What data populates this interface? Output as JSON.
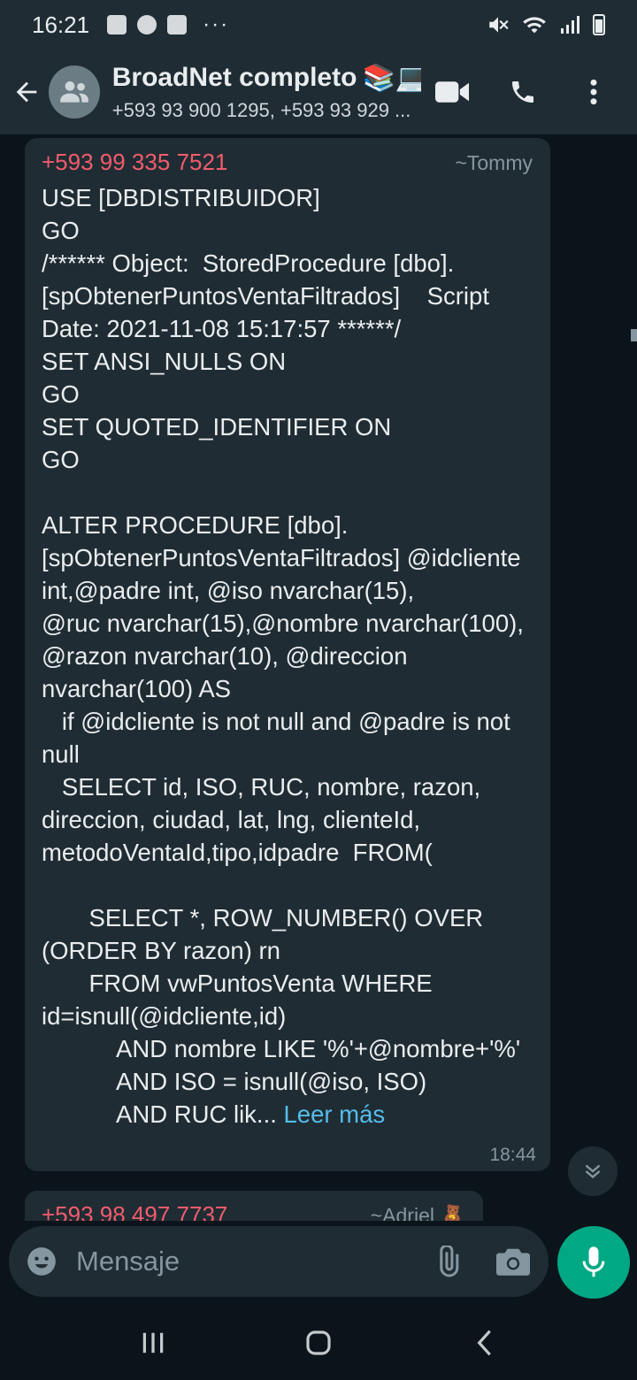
{
  "status_bar": {
    "time": "16:21",
    "more": "···"
  },
  "header": {
    "title": "BroadNet completo",
    "title_emoji": "📚💻",
    "subtitle": "+593 93 900 1295, +593 93 929 ..."
  },
  "messages": [
    {
      "sender_phone": "+593 99 335 7521",
      "sender_name": "~Tommy",
      "text": "USE [DBDISTRIBUIDOR]\nGO\n/****** Object:  StoredProcedure [dbo].[spObtenerPuntosVentaFiltrados]    Script Date: 2021-11-08 15:17:57 ******/\nSET ANSI_NULLS ON\nGO\nSET QUOTED_IDENTIFIER ON\nGO\n\nALTER PROCEDURE [dbo].[spObtenerPuntosVentaFiltrados] @idcliente int,@padre int, @iso nvarchar(15),\n@ruc nvarchar(15),@nombre nvarchar(100), @razon nvarchar(10), @direccion nvarchar(100) AS\n   if @idcliente is not null and @padre is not null\n   SELECT id, ISO, RUC, nombre, razon, direccion, ciudad, lat, lng, clienteId, metodoVentaId,tipo,idpadre  FROM(\n\n       SELECT *, ROW_NUMBER() OVER (ORDER BY razon) rn\n       FROM vwPuntosVenta WHERE id=isnull(@idcliente,id)\n           AND nombre LIKE '%'+@nombre+'%'\n           AND ISO = isnull(@iso, ISO)\n           AND RUC lik... ",
      "read_more": "Leer más",
      "time": "18:44"
    },
    {
      "sender_phone": "+593 98 497 7737",
      "sender_name": "~Adriel 🧸"
    }
  ],
  "input": {
    "placeholder": "Mensaje"
  },
  "colors": {
    "background": "#0b141a",
    "bar": "#1f2c34",
    "bubble": "#202c33",
    "sender_phone": "#f15c6d",
    "link": "#53bdeb",
    "accent": "#00a884"
  }
}
